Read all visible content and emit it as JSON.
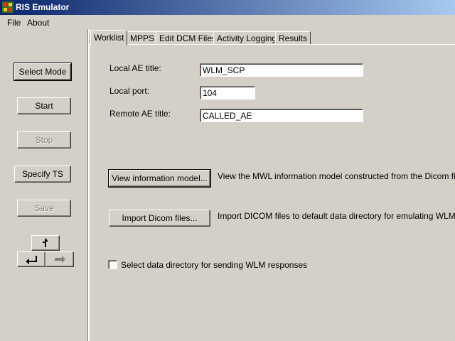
{
  "window": {
    "title": "RIS Emulator"
  },
  "menu": {
    "file": "File",
    "about": "About"
  },
  "left": {
    "select_mode": "Select Mode",
    "start": "Start",
    "stop": "Stop",
    "specify_ts": "Specify TS",
    "save": "Save"
  },
  "tabs": [
    "Worklist",
    "MPPS",
    "Edit DCM Files",
    "Activity Logging",
    "Results"
  ],
  "worklist": {
    "local_ae_label": "Local AE title:",
    "local_ae_value": "WLM_SCP",
    "local_port_label": "Local port:",
    "local_port_value": "104",
    "remote_ae_label": "Remote AE title:",
    "remote_ae_value": "CALLED_AE",
    "view_model_button": "View information model...",
    "view_model_desc": "View the MWL information model constructed from the Dicom files.",
    "import_button": "Import Dicom files...",
    "import_desc": "Import DICOM files to default data directory for emulating WLM responses.",
    "select_dir_label": "Select data directory for sending WLM responses",
    "select_dir_checked": false
  },
  "colors": {
    "titlebar_start": "#0a246a",
    "titlebar_end": "#a6caf0",
    "face": "#d4d0c8"
  },
  "icons": {
    "app": "ris-app-icon",
    "up": "arrow-up-icon",
    "back": "arrow-back-icon",
    "forward": "arrow-forward-icon"
  }
}
